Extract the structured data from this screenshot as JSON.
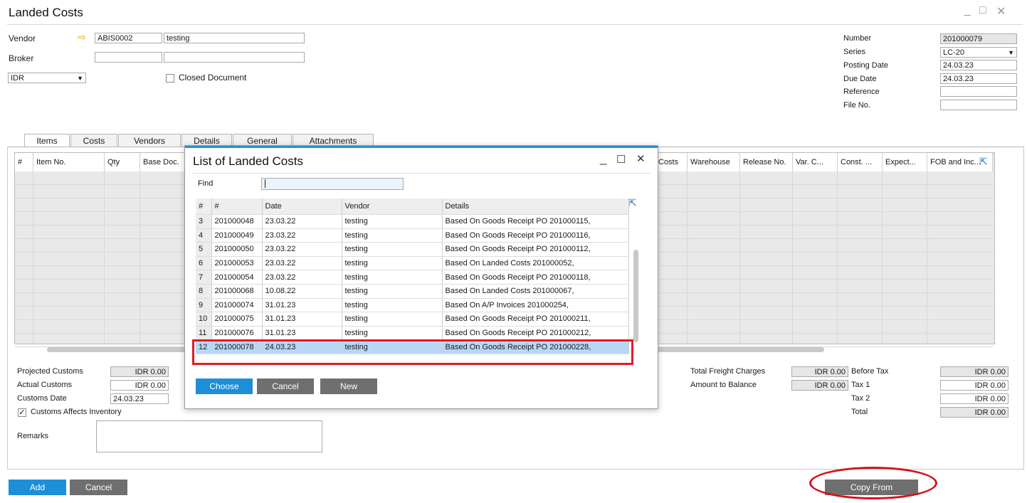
{
  "window": {
    "title": "Landed Costs",
    "minimize": "_",
    "maximize": "□",
    "close": "✕"
  },
  "header": {
    "vendor_label": "Vendor",
    "vendor_code": "ABIS0002",
    "vendor_name": "testing",
    "broker_label": "Broker",
    "broker_code": "",
    "broker_name": "",
    "currency": "IDR",
    "closed_label": "Closed Document",
    "number_label": "Number",
    "number_value": "201000079",
    "series_label": "Series",
    "series_value": "LC-20",
    "posting_label": "Posting Date",
    "posting_value": "24.03.23",
    "due_label": "Due Date",
    "due_value": "24.03.23",
    "reference_label": "Reference",
    "reference_value": "",
    "file_label": "File No.",
    "file_value": ""
  },
  "tabs": [
    "Items",
    "Costs",
    "Vendors",
    "Details",
    "General",
    "Attachments"
  ],
  "grid": {
    "columns_left": [
      "#",
      "Item No.",
      "Qty",
      "Base Doc."
    ],
    "columns_right": [
      "Costs",
      "Warehouse",
      "Release No.",
      "Var. C...",
      "Const. ...",
      "Expect...",
      "FOB and Inc..."
    ]
  },
  "footer_left": {
    "projected_label": "Projected Customs",
    "projected_value": "IDR 0.00",
    "actual_label": "Actual Customs",
    "actual_value": "IDR 0.00",
    "customs_date_label": "Customs Date",
    "customs_date_value": "24.03.23",
    "affects_label": "Customs Affects Inventory",
    "remarks_label": "Remarks"
  },
  "footer_right": {
    "freight_label": "Total Freight Charges",
    "freight_value": "IDR 0.00",
    "balance_label": "Amount to Balance",
    "balance_value": "IDR 0.00",
    "before_tax_label": "Before Tax",
    "before_tax_value": "IDR 0.00",
    "tax1_label": "Tax 1",
    "tax1_value": "IDR 0.00",
    "tax2_label": "Tax 2",
    "tax2_value": "IDR 0.00",
    "total_label": "Total",
    "total_value": "IDR 0.00"
  },
  "buttons": {
    "add": "Add",
    "cancel": "Cancel",
    "copy_from": "Copy From"
  },
  "dialog": {
    "title": "List of Landed Costs",
    "find_label": "Find",
    "find_value": "",
    "columns": [
      "#",
      "#",
      "Date",
      "Vendor",
      "Details"
    ],
    "rows": [
      [
        "3",
        "201000048",
        "23.03.22",
        "testing",
        "Based On Goods Receipt PO 201000115,"
      ],
      [
        "4",
        "201000049",
        "23.03.22",
        "testing",
        "Based On Goods Receipt PO 201000116,"
      ],
      [
        "5",
        "201000050",
        "23.03.22",
        "testing",
        "Based On Goods Receipt PO 201000112,"
      ],
      [
        "6",
        "201000053",
        "23.03.22",
        "testing",
        "Based On Landed Costs 201000052,"
      ],
      [
        "7",
        "201000054",
        "23.03.22",
        "testing",
        "Based On Goods Receipt PO 201000118,"
      ],
      [
        "8",
        "201000068",
        "10.08.22",
        "testing",
        "Based On Landed Costs 201000067,"
      ],
      [
        "9",
        "201000074",
        "31.01.23",
        "testing",
        "Based On A/P Invoices 201000254,"
      ],
      [
        "10",
        "201000075",
        "31.01.23",
        "testing",
        "Based On Goods Receipt PO 201000211,"
      ],
      [
        "11",
        "201000076",
        "31.01.23",
        "testing",
        "Based On Goods Receipt PO 201000212,"
      ],
      [
        "12",
        "201000078",
        "24.03.23",
        "testing",
        "Based On Goods Receipt PO 201000228,"
      ]
    ],
    "selected_row": "12",
    "choose": "Choose",
    "cancel": "Cancel",
    "new": "New"
  },
  "colors": {
    "accent": "#1d8fd9",
    "highlight": "#e01b24",
    "selected_row": "#b8d7f5"
  }
}
